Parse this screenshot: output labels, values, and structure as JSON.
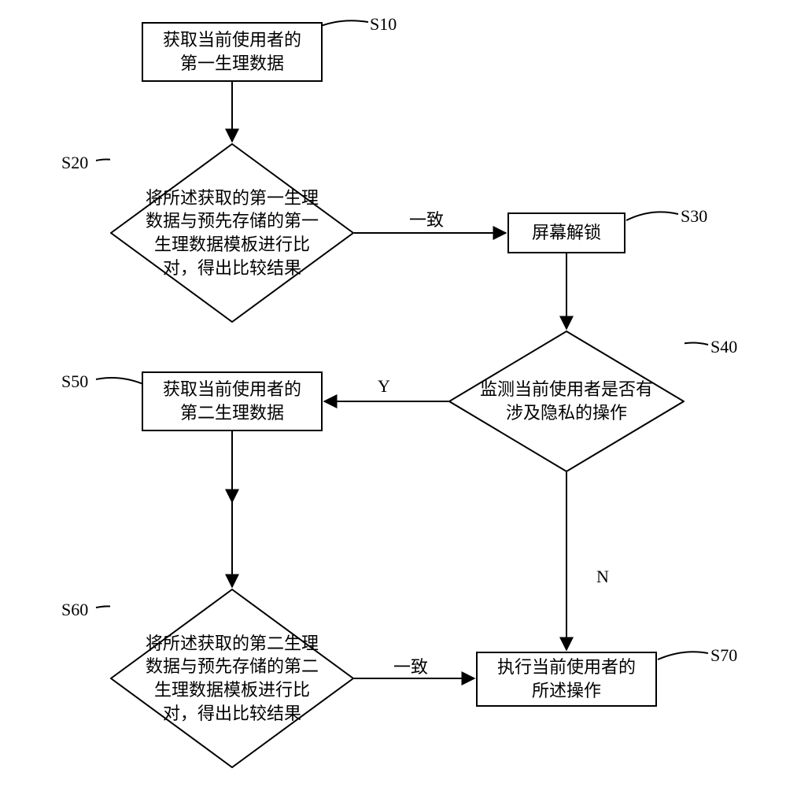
{
  "flowchart": {
    "nodes": {
      "s10": {
        "label": "S10",
        "text": "获取当前使用者的\n第一生理数据"
      },
      "s20": {
        "label": "S20",
        "text": "将所述获取的第一生理数据与预先存储的第一生理数据模板进行比对，得出比较结果"
      },
      "s30": {
        "label": "S30",
        "text": "屏幕解锁"
      },
      "s40": {
        "label": "S40",
        "text": "监测当前使用者是否有涉及隐私的操作"
      },
      "s50": {
        "label": "S50",
        "text": "获取当前使用者的\n第二生理数据"
      },
      "s60": {
        "label": "S60",
        "text": "将所述获取的第二生理数据与预先存储的第二生理数据模板进行比对，得出比较结果"
      },
      "s70": {
        "label": "S70",
        "text": "执行当前使用者的\n所述操作"
      }
    },
    "edges": {
      "s20_s30": "一致",
      "s40_s50": "Y",
      "s40_s70": "N",
      "s60_s70": "一致"
    }
  }
}
